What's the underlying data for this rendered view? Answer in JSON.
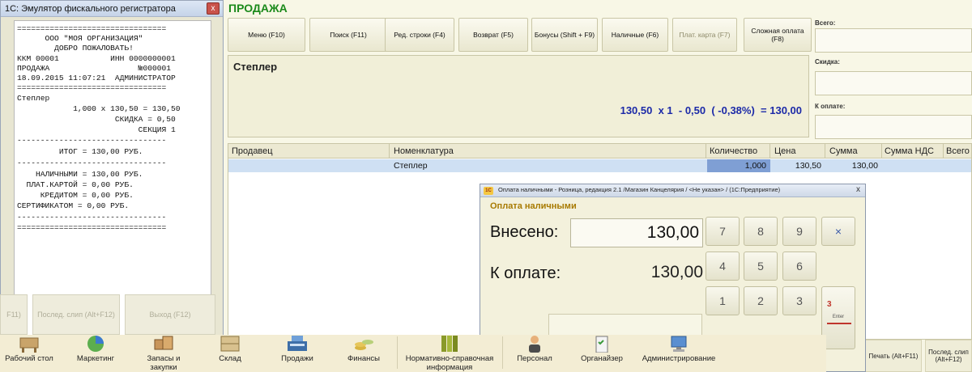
{
  "pos": {
    "title": "ПРОДАЖА",
    "buttons": [
      {
        "label": "Меню (F10)",
        "enabled": true
      },
      {
        "label": "Поиск (F11)",
        "enabled": true
      },
      {
        "label": "Ред. строки (F4)",
        "enabled": true
      },
      {
        "label": "Возврат (F5)",
        "enabled": true
      },
      {
        "label": "Бонусы (Shift + F9)",
        "enabled": true
      },
      {
        "label": "Наличные (F6)",
        "enabled": true
      },
      {
        "label": "Плат. карта (F7)",
        "enabled": false
      },
      {
        "label": "Сложная оплата (F8)",
        "enabled": true
      }
    ],
    "current_item": {
      "name": "Степлер",
      "calculation": "130,50  x 1  - 0,50  ( -0,38%)  = 130,00"
    },
    "side": {
      "total_label": "Всего:",
      "discount_label": "Скидка:",
      "to_pay_label": "К оплате:"
    },
    "table": {
      "headers": [
        "Продавец",
        "Номенклатура",
        "Количество",
        "Цена",
        "Сумма",
        "Сумма НДС",
        "Всего"
      ],
      "rows": [
        {
          "seller": "",
          "item": "Степлер",
          "qty": "1,000",
          "price": "130,50",
          "sum": "130,00",
          "vat": "",
          "total": ""
        }
      ]
    },
    "print_buttons": [
      "Печать (Alt+F11)",
      "Послед. слип (Alt+F12)"
    ]
  },
  "fiscal": {
    "title": "1С: Эмулятор фискального регистратора",
    "close": "x",
    "receipt_lines": [
      "================================",
      "      ООО \"МОЯ ОРГАНИЗАЦИЯ\"",
      "        ДОБРО ПОЖАЛОВАТЬ!",
      "ККМ 00001           ИНН 0000000001",
      "ПРОДАЖА                   №000001",
      "18.09.2015 11:07:21  АДМИНИСТРАТОР",
      "================================",
      "Степлер",
      "            1,000 x 130,50 = 130,50",
      "                     СКИДКА = 0,50",
      "                          СЕКЦИЯ 1",
      "--------------------------------",
      "         ИТОГ = 130,00 РУБ.",
      "--------------------------------",
      "    НАЛИЧНЫМИ = 130,00 РУБ.",
      "  ПЛАТ.КАРТОЙ = 0,00 РУБ.",
      "     КРЕДИТОМ = 0,00 РУБ.",
      "СЕРТИФИКАТОМ = 0,00 РУБ.",
      "--------------------------------",
      "================================"
    ],
    "ghost_buttons": [
      "F11)",
      "Послед. слип (Alt+F12)",
      "Выход (F12)"
    ]
  },
  "payment": {
    "window_title": "Оплата наличными - Розница, редакция 2.1 /Магазин Канцелярия / <Не указан> / (1С:Предприятие)",
    "logo": "1С",
    "close": "x",
    "subtitle": "Оплата наличными",
    "paid_label": "Внесено:",
    "paid_value": "130,00",
    "to_pay_label": "К оплате:",
    "to_pay_value": "130,00",
    "keys": [
      "7",
      "8",
      "9",
      "×",
      "4",
      "5",
      "6",
      "1",
      "2",
      "3"
    ],
    "enter_number": "3",
    "enter_label": "Enter"
  },
  "taskbar": {
    "items": [
      {
        "label": "Рабочий стол",
        "icon": "desk-icon"
      },
      {
        "label": "Маркетинг",
        "icon": "pie-chart-icon"
      },
      {
        "label": "Запасы и закупки",
        "icon": "boxes-icon"
      },
      {
        "label": "Склад",
        "icon": "warehouse-icon"
      },
      {
        "label": "Продажи",
        "icon": "cash-register-icon"
      },
      {
        "label": "Финансы",
        "icon": "coins-icon"
      },
      {
        "label": "Нормативно-справочная информация",
        "icon": "binders-icon"
      },
      {
        "label": "Персонал",
        "icon": "person-icon"
      },
      {
        "label": "Органайзер",
        "icon": "clipboard-icon"
      },
      {
        "label": "Администрирование",
        "icon": "computer-icon"
      }
    ]
  }
}
